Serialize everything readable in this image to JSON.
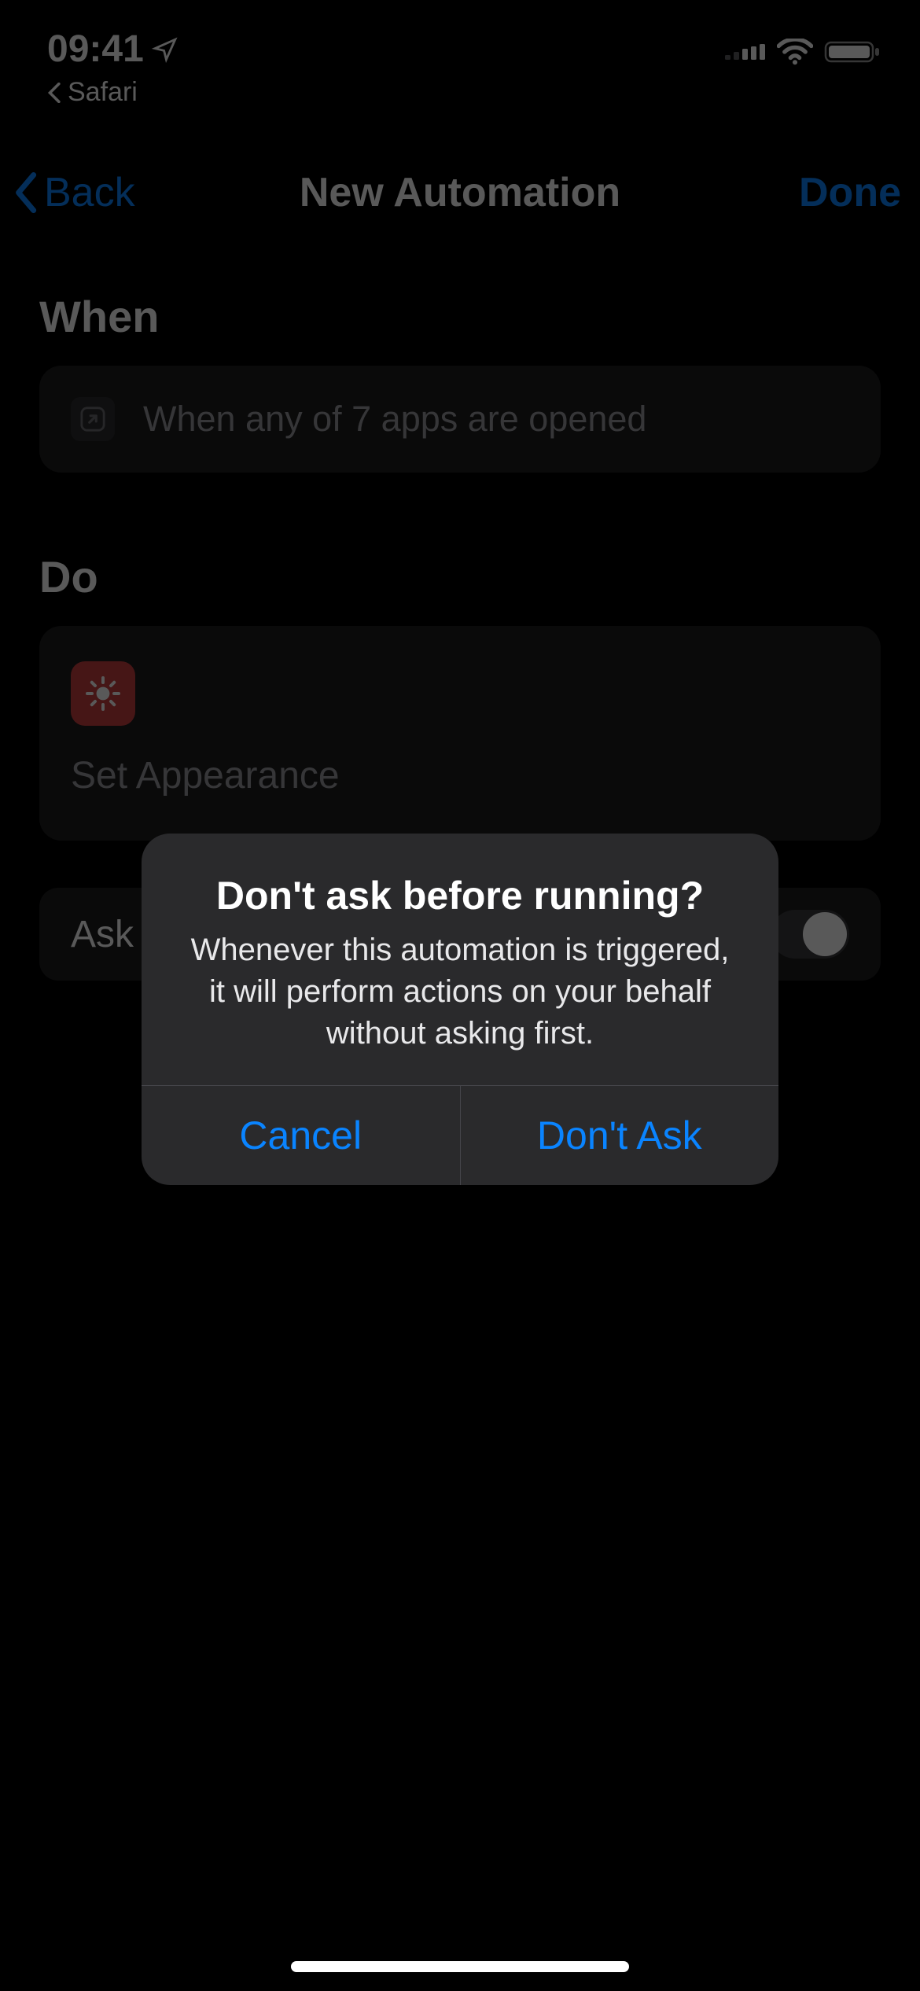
{
  "status": {
    "time": "09:41",
    "back_app": "Safari"
  },
  "nav": {
    "back": "Back",
    "title": "New Automation",
    "done": "Done"
  },
  "sections": {
    "when": {
      "header": "When",
      "trigger_text": "When any of 7 apps are opened"
    },
    "do": {
      "header": "Do",
      "action_title": "Set Appearance"
    },
    "ask": {
      "label": "Ask"
    }
  },
  "alert": {
    "title": "Don't ask before running?",
    "message": "Whenever this automation is triggered, it will perform actions on your behalf without asking first.",
    "cancel": "Cancel",
    "confirm": "Don't Ask"
  },
  "colors": {
    "accent": "#0a84ff",
    "action_icon_bg": "#c93f3f"
  }
}
